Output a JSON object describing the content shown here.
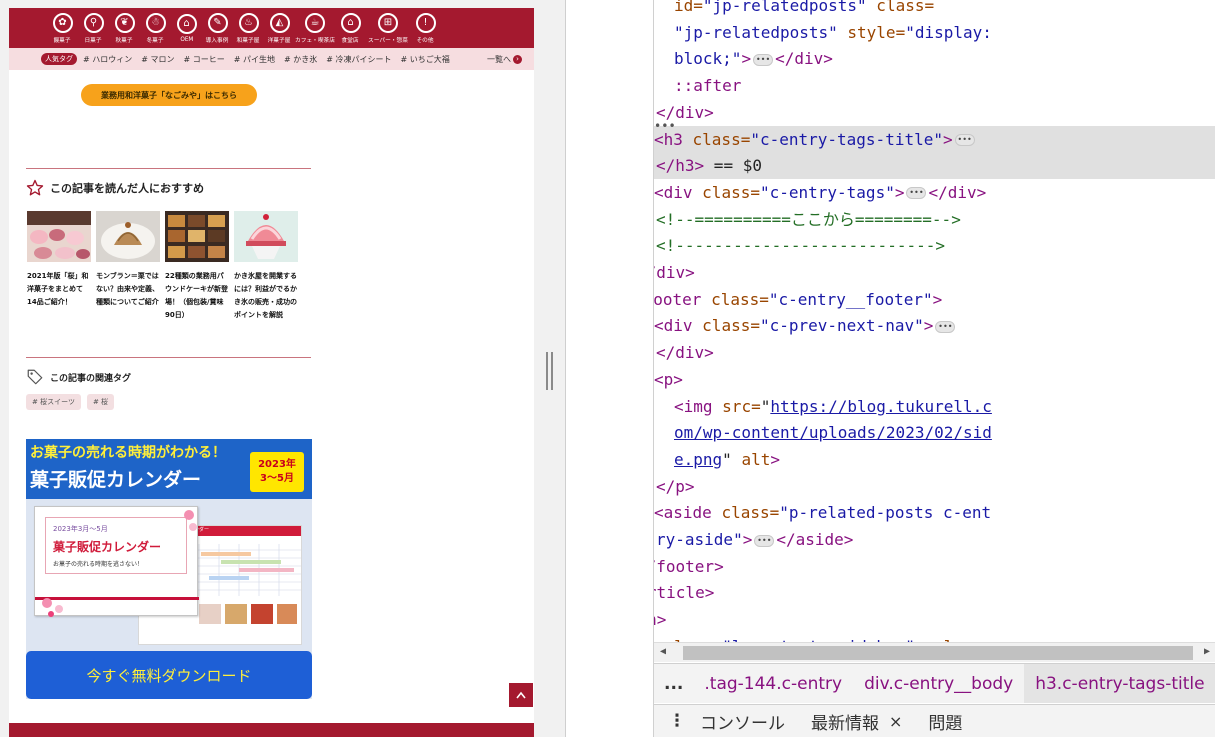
{
  "site": {
    "categories": [
      {
        "label": "饅菓子",
        "icon": "flower-icon"
      },
      {
        "label": "日菓子",
        "icon": "dango-icon"
      },
      {
        "label": "秋菓子",
        "icon": "maple-icon"
      },
      {
        "label": "冬菓子",
        "icon": "snowman-icon"
      },
      {
        "label": "OEM",
        "icon": "factory-icon"
      },
      {
        "label": "導入事例",
        "icon": "case-icon"
      },
      {
        "label": "和菓子屋",
        "icon": "wagashi-icon"
      },
      {
        "label": "洋菓子屋",
        "icon": "cake-icon"
      },
      {
        "label": "カフェ・喫茶店",
        "icon": "cup-icon"
      },
      {
        "label": "食堂店",
        "icon": "shop-icon"
      },
      {
        "label": "スーパー・惣菜",
        "icon": "basket-icon"
      },
      {
        "label": "その他",
        "icon": "info-icon"
      }
    ],
    "tagbar": {
      "label": "人気タグ",
      "tags": [
        "# ハロウィン",
        "# マロン",
        "# コーヒー",
        "# パイ生地",
        "# かき氷",
        "# 冷凍パイシート",
        "# いちご大福"
      ],
      "more": "一覧へ"
    },
    "orange_button": "業務用和洋菓子「なごみや」はこちら",
    "recommend_title": "この記事を読んだ人におすすめ",
    "recommend": [
      {
        "caption": "2021年版「桜」和洋菓子をまとめて14品ご紹介！"
      },
      {
        "caption": "モンブラン＝栗ではない？由来や定義、種類についてご紹介"
      },
      {
        "caption": "22種類の業務用パウンドケーキが新登場！（個包装/賞味90日）"
      },
      {
        "caption": "かき氷屋を開業するには？利益がでるかき氷の販売・成功のポイントを解説"
      }
    ],
    "tags_title": "この記事の関連タグ",
    "tags": [
      "# 桜スイーツ",
      "# 桜"
    ],
    "banner": {
      "line1": "お菓子の売れる時期がわかる！",
      "line2": "菓子販促カレンダー",
      "year": "2023年",
      "months": "3〜5月",
      "card_date": "2023年3月〜5月",
      "card_title": "菓子販促カレンダー",
      "card_sub": "お菓子の売れる時期を逃さない！",
      "sheet_title": "レンダー",
      "download": "今すぐ無料ダウンロード"
    },
    "totop": "^"
  },
  "devtools": {
    "lines": [
      {
        "indent": 220,
        "parts": [
          {
            "c": "attr",
            "t": "id="
          },
          {
            "c": "val",
            "t": "\"jp-relatedposts\""
          },
          {
            "c": "attr",
            "t": " class="
          }
        ]
      },
      {
        "indent": 220,
        "parts": [
          {
            "c": "val",
            "t": "\"jp-relatedposts\""
          },
          {
            "c": "attr",
            "t": " style="
          },
          {
            "c": "val",
            "t": "\"display:"
          }
        ]
      },
      {
        "indent": 220,
        "parts": [
          {
            "c": "val",
            "t": "block;\""
          },
          {
            "c": "tag",
            "t": ">"
          },
          {
            "c": "ell",
            "t": "•••"
          },
          {
            "c": "tag",
            "t": "</div>"
          }
        ]
      },
      {
        "indent": 220,
        "parts": [
          {
            "c": "tag",
            "t": "::after"
          }
        ]
      },
      {
        "indent": 202,
        "parts": [
          {
            "c": "tag",
            "t": "</div>"
          }
        ]
      },
      {
        "indent": 188,
        "tri": "▶",
        "sel": true,
        "parts": [
          {
            "c": "tag",
            "t": "<h3 "
          },
          {
            "c": "attr",
            "t": "class="
          },
          {
            "c": "val",
            "t": "\"c-entry-tags-title\""
          },
          {
            "c": "tag",
            "t": ">"
          },
          {
            "c": "ell",
            "t": "•••"
          }
        ]
      },
      {
        "indent": 202,
        "sel": true,
        "parts": [
          {
            "c": "tag",
            "t": "</h3>"
          },
          {
            "c": "txt",
            "t": " == $0"
          }
        ]
      },
      {
        "indent": 188,
        "tri": "▶",
        "parts": [
          {
            "c": "tag",
            "t": "<div "
          },
          {
            "c": "attr",
            "t": "class="
          },
          {
            "c": "val",
            "t": "\"c-entry-tags\""
          },
          {
            "c": "tag",
            "t": ">"
          },
          {
            "c": "ell",
            "t": "•••"
          },
          {
            "c": "tag",
            "t": "</div>"
          }
        ]
      },
      {
        "indent": 202,
        "parts": [
          {
            "c": "cm",
            "t": "<!--==========ここから========-->"
          }
        ]
      },
      {
        "indent": 202,
        "parts": [
          {
            "c": "cm",
            "t": "<!--------------------------->"
          }
        ]
      },
      {
        "indent": 183,
        "parts": [
          {
            "c": "tag",
            "t": "</div>"
          }
        ]
      },
      {
        "indent": 168,
        "tri": "▼",
        "parts": [
          {
            "c": "tag",
            "t": "<footer "
          },
          {
            "c": "attr",
            "t": "class="
          },
          {
            "c": "val",
            "t": "\"c-entry__footer\""
          },
          {
            "c": "tag",
            "t": ">"
          }
        ]
      },
      {
        "indent": 188,
        "tri": "▶",
        "parts": [
          {
            "c": "tag",
            "t": "<div "
          },
          {
            "c": "attr",
            "t": "class="
          },
          {
            "c": "val",
            "t": "\"c-prev-next-nav\""
          },
          {
            "c": "tag",
            "t": ">"
          },
          {
            "c": "ell",
            "t": "•••"
          }
        ]
      },
      {
        "indent": 202,
        "parts": [
          {
            "c": "tag",
            "t": "</div>"
          }
        ]
      },
      {
        "indent": 188,
        "tri": "▼",
        "parts": [
          {
            "c": "tag",
            "t": "<p>"
          }
        ]
      },
      {
        "indent": 220,
        "parts": [
          {
            "c": "tag",
            "t": "<img "
          },
          {
            "c": "attr",
            "t": "src="
          },
          {
            "c": "txt",
            "t": "\""
          },
          {
            "c": "lnk",
            "t": "https://blog.tukurell.c"
          }
        ]
      },
      {
        "indent": 220,
        "parts": [
          {
            "c": "lnk",
            "t": "om/wp-content/uploads/2023/02/sid"
          }
        ]
      },
      {
        "indent": 220,
        "parts": [
          {
            "c": "lnk",
            "t": "e.png"
          },
          {
            "c": "txt",
            "t": "\""
          },
          {
            "c": "attr",
            "t": " alt"
          },
          {
            "c": "tag",
            "t": ">"
          }
        ]
      },
      {
        "indent": 202,
        "parts": [
          {
            "c": "tag",
            "t": "</p>"
          }
        ]
      },
      {
        "indent": 188,
        "tri": "▶",
        "parts": [
          {
            "c": "tag",
            "t": "<aside "
          },
          {
            "c": "attr",
            "t": "class="
          },
          {
            "c": "val",
            "t": "\"p-related-posts c-ent"
          }
        ]
      },
      {
        "indent": 202,
        "parts": [
          {
            "c": "val",
            "t": "ry-aside\""
          },
          {
            "c": "tag",
            "t": ">"
          },
          {
            "c": "ell",
            "t": "•••"
          },
          {
            "c": "tag",
            "t": "</aside>"
          }
        ]
      },
      {
        "indent": 183,
        "parts": [
          {
            "c": "tag",
            "t": "</footer>"
          }
        ]
      },
      {
        "indent": 164,
        "parts": [
          {
            "c": "tag",
            "t": "</article>"
          }
        ]
      },
      {
        "indent": 145,
        "parts": [
          {
            "c": "tag",
            "t": "</main>"
          }
        ]
      },
      {
        "indent": 131,
        "tri": "▶",
        "parts": [
          {
            "c": "tag",
            "t": "<aside "
          },
          {
            "c": "attr",
            "t": "class="
          },
          {
            "c": "val",
            "t": "\"l-contents  sidebar\""
          },
          {
            "c": "attr",
            "t": " role="
          }
        ]
      }
    ],
    "breadcrumbs": [
      "...",
      ".tag-144.c-entry",
      "div.c-entry__body",
      "h3.c-entry-tags-title",
      "."
    ],
    "drawer_tabs": [
      "コンソール",
      "最新情報",
      "問題"
    ],
    "drawer_close": "×"
  }
}
